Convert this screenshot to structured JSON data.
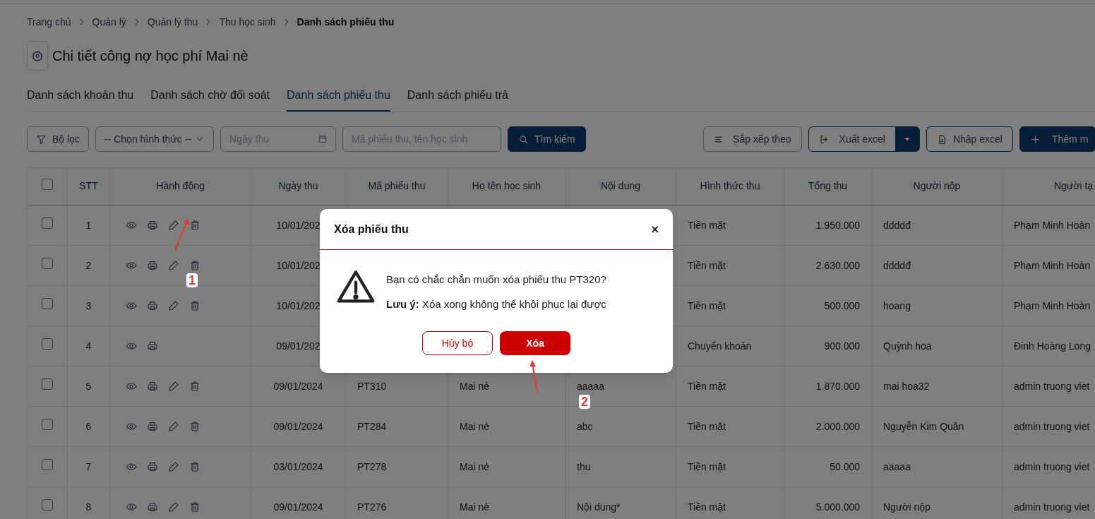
{
  "breadcrumb": [
    {
      "label": "Trang chủ",
      "current": false
    },
    {
      "label": "Quản lý",
      "current": false
    },
    {
      "label": "Quản lý thu",
      "current": false
    },
    {
      "label": "Thu học sinh",
      "current": false
    },
    {
      "label": "Danh sách phiếu thu",
      "current": true
    }
  ],
  "page_title": "Chi tiết công nợ học phí Mai nè",
  "tabs": [
    {
      "label": "Danh sách khoản thu",
      "selected": false
    },
    {
      "label": "Danh sách chờ đối soát",
      "selected": false
    },
    {
      "label": "Danh sách phiếu thu",
      "selected": true
    },
    {
      "label": "Danh sách phiếu trả",
      "selected": false
    }
  ],
  "toolbar": {
    "filter_button": "Bộ lọc",
    "method_select": "-- Chọn hình thức --",
    "date_field": {
      "placeholder": "Ngày thu"
    },
    "search_field": {
      "placeholder": "Mã phiếu thu, tên học sinh"
    },
    "search_button": "Tìm kiếm",
    "sort_button": "Sắp xếp theo",
    "export_button": "Xuất excel",
    "import_button": "Nhập excel",
    "add_button": "Thêm m"
  },
  "table": {
    "header_checked": false,
    "columns": [
      "STT",
      "Hành động",
      "Ngày thu",
      "Mã phiếu thu",
      "Họ tên học sinh",
      "Nội dung",
      "Hình thức thu",
      "Tổng thu",
      "Người nộp",
      "Người tạ"
    ],
    "rows": [
      {
        "checked": false,
        "stt": "1",
        "editable": true,
        "date": "10/01/202",
        "method": "Tiền mặt",
        "total": "1.950.000",
        "payer": "ddddđ",
        "creator": "Phạm Minh Hoàn"
      },
      {
        "checked": false,
        "stt": "2",
        "editable": true,
        "date": "10/01/202",
        "method": "Tiền mặt",
        "total": "2.630.000",
        "payer": "ddddđ",
        "creator": "Phạm Minh Hoàn"
      },
      {
        "checked": false,
        "stt": "3",
        "editable": true,
        "date": "10/01/202",
        "method": "Tiền mặt",
        "total": "500.000",
        "payer": "hoang",
        "creator": "Phạm Minh Hoàn"
      },
      {
        "checked": false,
        "stt": "4",
        "editable": false,
        "date": "09/01/202",
        "method": "Chuyển khoản",
        "total": "900.000",
        "payer": "Quỳnh hoa",
        "creator": "Đinh Hoàng Long"
      },
      {
        "checked": false,
        "stt": "5",
        "editable": true,
        "date": "09/01/2024",
        "code": "PT310",
        "student": "Mai nè",
        "content": "aaaaa",
        "method": "Tiền mặt",
        "total": "1.870.000",
        "payer": "mai hoa32",
        "creator": "admin truong viet"
      },
      {
        "checked": false,
        "stt": "6",
        "editable": true,
        "date": "09/01/2024",
        "code": "PT284",
        "student": "Mai nè",
        "content": "abc",
        "method": "Tiền mặt",
        "total": "2.000.000",
        "payer": "Nguyễn Kim Quân",
        "creator": "admin truong viet"
      },
      {
        "checked": false,
        "stt": "7",
        "editable": true,
        "date": "03/01/2024",
        "code": "PT278",
        "student": "Mai nè",
        "content": "thu",
        "method": "Tiền mặt",
        "total": "50.000",
        "payer": "aaaaa",
        "creator": "admin truong viet"
      },
      {
        "checked": false,
        "stt": "8",
        "editable": true,
        "date": "09/01/2024",
        "code": "PT276",
        "student": "Mai nè",
        "content": "Nội dung*",
        "method": "Tiền mặt",
        "total": "5.000.000",
        "payer": "Người nộp",
        "creator": "admin truong viet"
      }
    ]
  },
  "dialog": {
    "title": "Xóa phiếu thu",
    "close": "×",
    "question": "Bạn có chắc chắn muốn xóa phiếu thu PT320?",
    "note": "**Lưu ý:** Xóa xong không thể khôi phục lại được",
    "cancel_button": "Hủy bỏ",
    "confirm_button": "Xóa"
  },
  "annotations": [
    {
      "label": "1"
    },
    {
      "label": "2"
    }
  ]
}
